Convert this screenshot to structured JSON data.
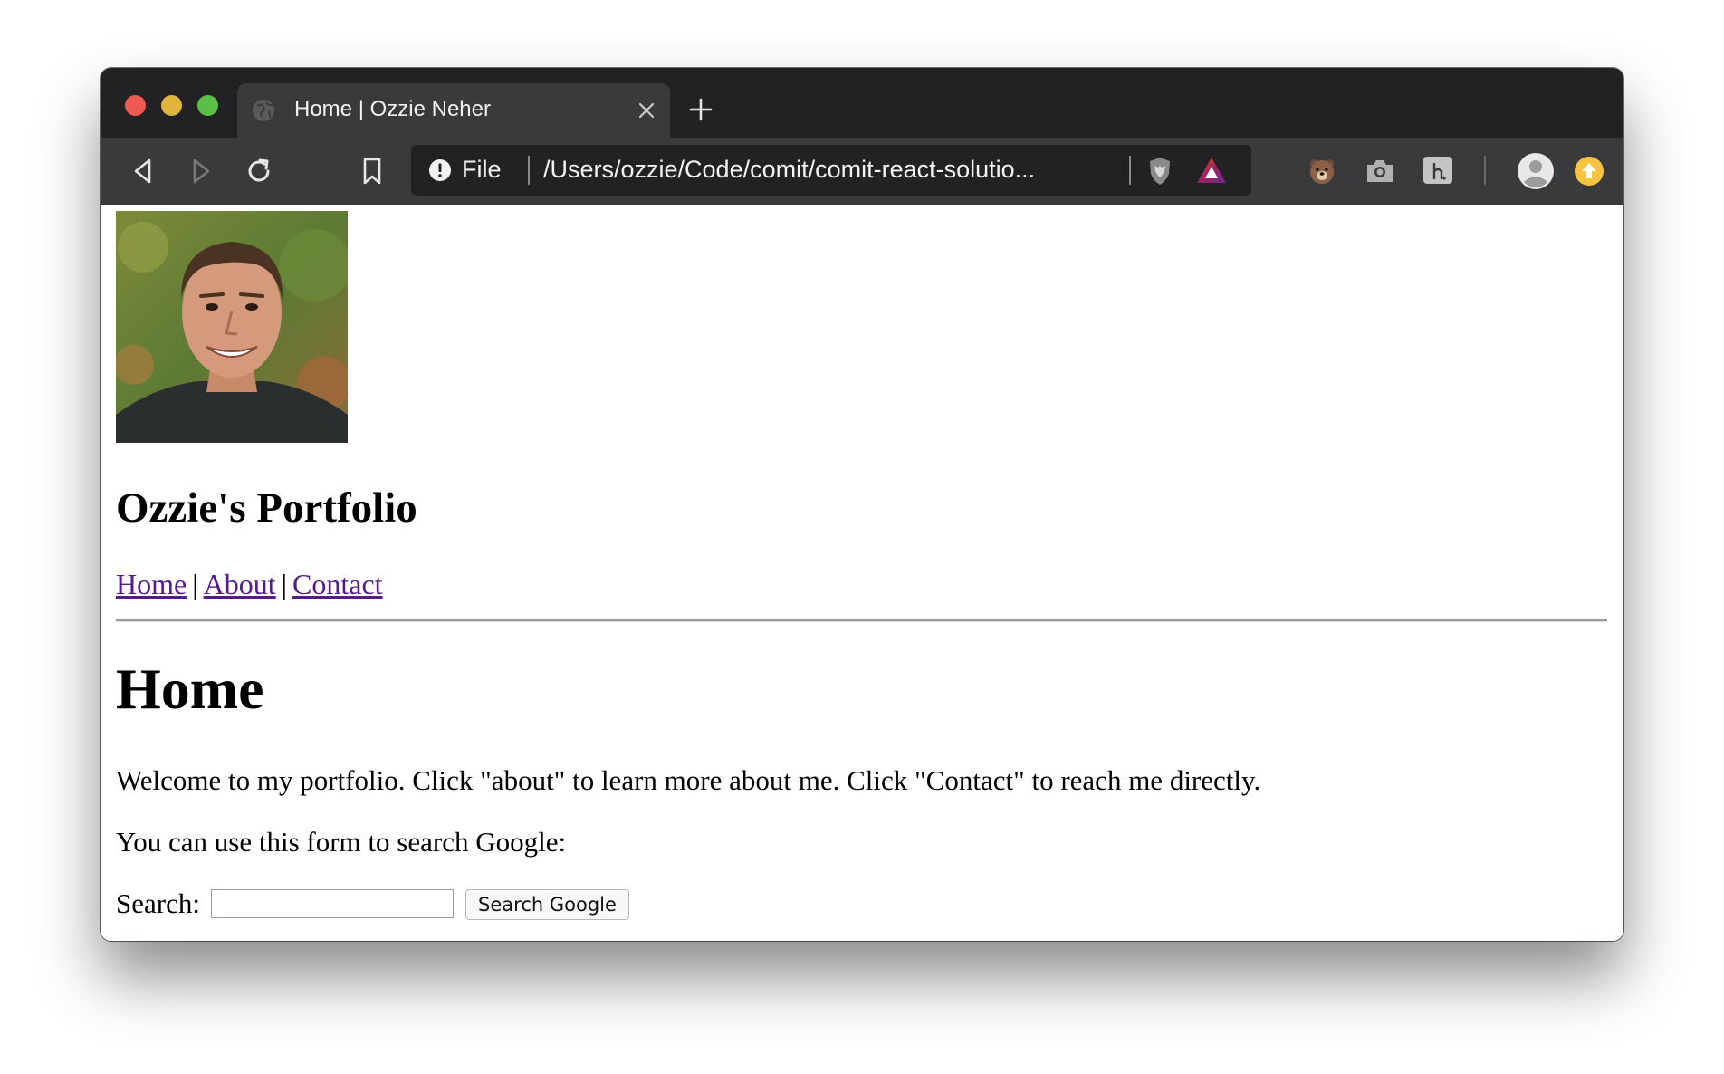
{
  "browser": {
    "tab": {
      "title": "Home | Ozzie Neher",
      "favicon": "globe-icon",
      "close_icon": "close-icon"
    },
    "new_tab_icon": "plus-icon",
    "toolbar": {
      "icons": [
        "back-icon",
        "forward-icon",
        "reload-icon",
        "bookmark-icon"
      ]
    },
    "address_bar": {
      "security_icon": "info-icon",
      "scheme_label": "File",
      "url": "/Users/ozzie/Code/comit/comit-react-solutio..."
    },
    "address_bar_icons": [
      "brave-shields-icon",
      "brave-rewards-icon"
    ],
    "extensions": [
      "bear-extension-icon",
      "camera-extension-icon",
      "hypothesis-extension-icon",
      "profile-avatar-icon",
      "update-icon"
    ],
    "colors": {
      "titlebar": "#222224",
      "toolbar": "#3a3a3c",
      "close": "#ee5a52",
      "minimize": "#e0b53c",
      "maximize": "#5bbf46"
    }
  },
  "page": {
    "photo": "portrait-photo",
    "site_title": "Ozzie's Portfolio",
    "nav": {
      "links": [
        "Home",
        "About",
        "Contact"
      ],
      "separator": "|",
      "link_color": "#551a8b"
    },
    "heading": "Home",
    "paragraphs": [
      "Welcome to my portfolio. Click \"about\" to learn more about me. Click \"Contact\" to reach me directly.",
      "You can use this form to search Google:"
    ],
    "search_form": {
      "label": "Search:",
      "input_value": "",
      "button_label": "Search Google"
    }
  }
}
